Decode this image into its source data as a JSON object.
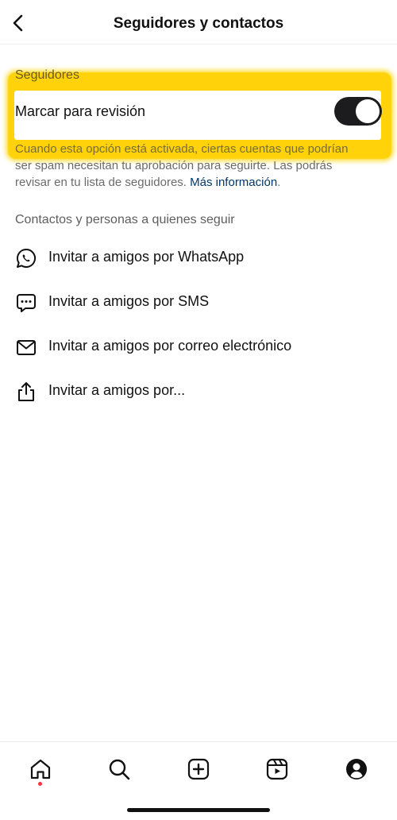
{
  "header": {
    "title": "Seguidores y contactos",
    "back_icon": "chevron-left-icon"
  },
  "followers_section": {
    "label": "Seguidores",
    "toggle": {
      "label": "Marcar para revisión",
      "state": true
    },
    "description_line1": "Cuando esta opción está activada, ciertas cuentas que podrían",
    "description_line2": "ser spam necesitan tu aprobación para seguirte. Las podrás",
    "description_line3": "revisar en tu lista de seguidores.",
    "more_info_link": "Más información",
    "period": "."
  },
  "contacts_section": {
    "label": "Contactos y personas a quienes seguir",
    "items": [
      {
        "label": "Invitar a amigos por WhatsApp",
        "icon": "whatsapp-icon"
      },
      {
        "label": "Invitar a amigos por SMS",
        "icon": "sms-bubble-icon"
      },
      {
        "label": "Invitar a amigos por correo electrónico",
        "icon": "mail-icon"
      },
      {
        "label": "Invitar a amigos por...",
        "icon": "share-icon"
      }
    ]
  },
  "tabbar": {
    "items": [
      {
        "name": "home",
        "icon": "home-icon",
        "active": true,
        "has_notification_dot": true
      },
      {
        "name": "search",
        "icon": "search-icon"
      },
      {
        "name": "create",
        "icon": "plus-square-icon"
      },
      {
        "name": "reels",
        "icon": "reels-icon"
      },
      {
        "name": "profile",
        "icon": "profile-icon"
      }
    ]
  },
  "colors": {
    "highlight": "#ffd20a",
    "toggle_on": "#1c1c1e",
    "link": "#00376b",
    "notification_dot": "#ff3040"
  }
}
